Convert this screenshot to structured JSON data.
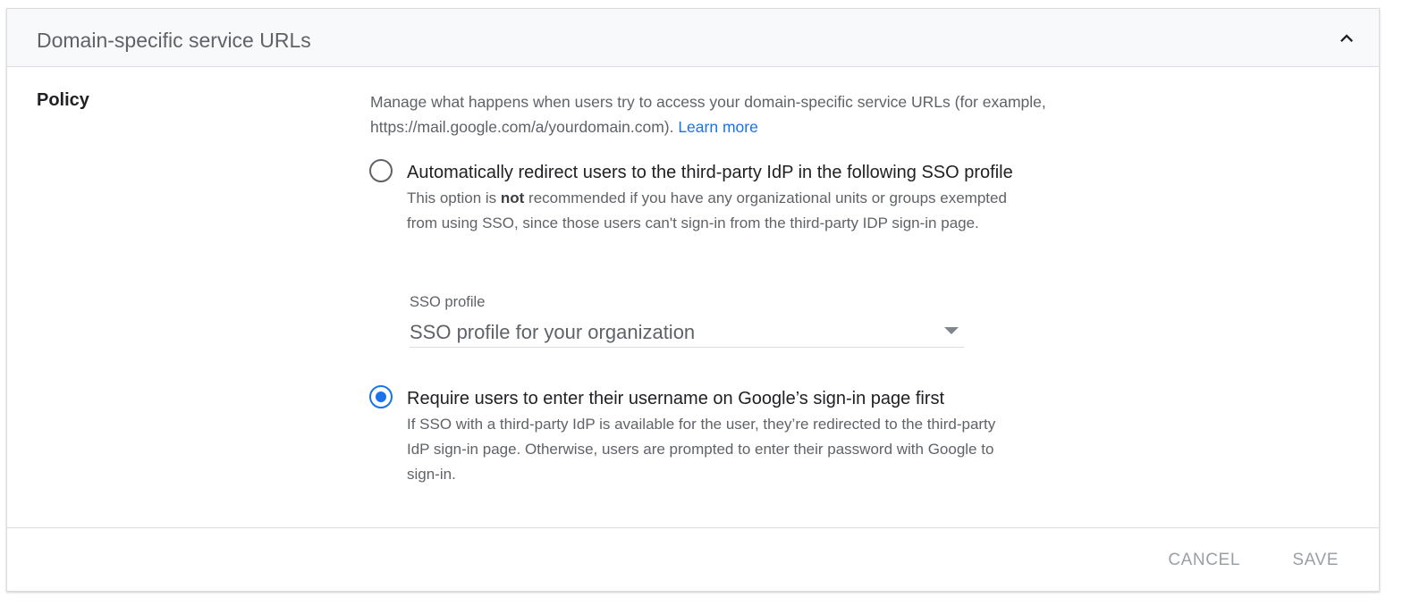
{
  "section": {
    "title": "Domain-specific service URLs",
    "collapse_icon": "chevron-up-icon"
  },
  "policy": {
    "label": "Policy",
    "description_text": "Manage what happens when users try to access your domain-specific service URLs (for example, https://mail.google.com/a/yourdomain.com). ",
    "learn_more": "Learn more"
  },
  "options": [
    {
      "label": "Automatically redirect users to the third-party IdP in the following SSO profile",
      "desc_pre": "This option is ",
      "desc_bold": "not",
      "desc_post": " recommended if you have any organizational units or groups exempted from using SSO, since those users can't sign-in from the third-party IDP sign-in page.",
      "selected": false
    },
    {
      "label": "Require users to enter their username on Google’s sign-in page first",
      "desc": "If SSO with a third-party IdP is available for the user, they’re redirected to the third-party IdP sign-in page. Otherwise, users are prompted to enter their password with Google to sign-in.",
      "selected": true
    }
  ],
  "sso_profile": {
    "caption": "SSO profile",
    "value": "SSO profile for your organization",
    "arrow_icon": "dropdown-arrow-icon"
  },
  "footer": {
    "cancel_label": "CANCEL",
    "save_label": "SAVE"
  },
  "colors": {
    "accent": "#1a73e8",
    "muted_text": "#5f6368",
    "disabled_button": "#9aa0a6"
  }
}
